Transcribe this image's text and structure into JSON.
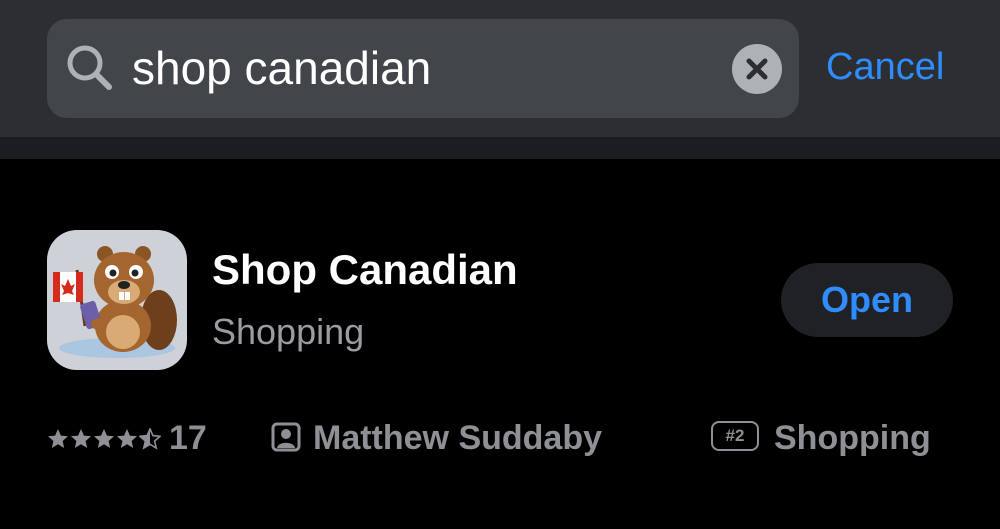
{
  "search": {
    "query": "shop canadian",
    "cancel_label": "Cancel"
  },
  "result": {
    "app_name": "Shop Canadian",
    "category": "Shopping",
    "open_label": "Open",
    "rating_stars": 4.5,
    "rating_count": "17",
    "developer": "Matthew Suddaby",
    "rank": "#2",
    "rank_category": "Shopping"
  },
  "icons": {
    "search": "magnifier-icon",
    "clear": "clear-x-icon",
    "developer": "person-icon",
    "app": "beaver-with-canada-flag-icon"
  },
  "colors": {
    "accent": "#2f8cff",
    "background": "#000000",
    "search_bar": "#2c2e31",
    "secondary_text": "#8e9095"
  }
}
